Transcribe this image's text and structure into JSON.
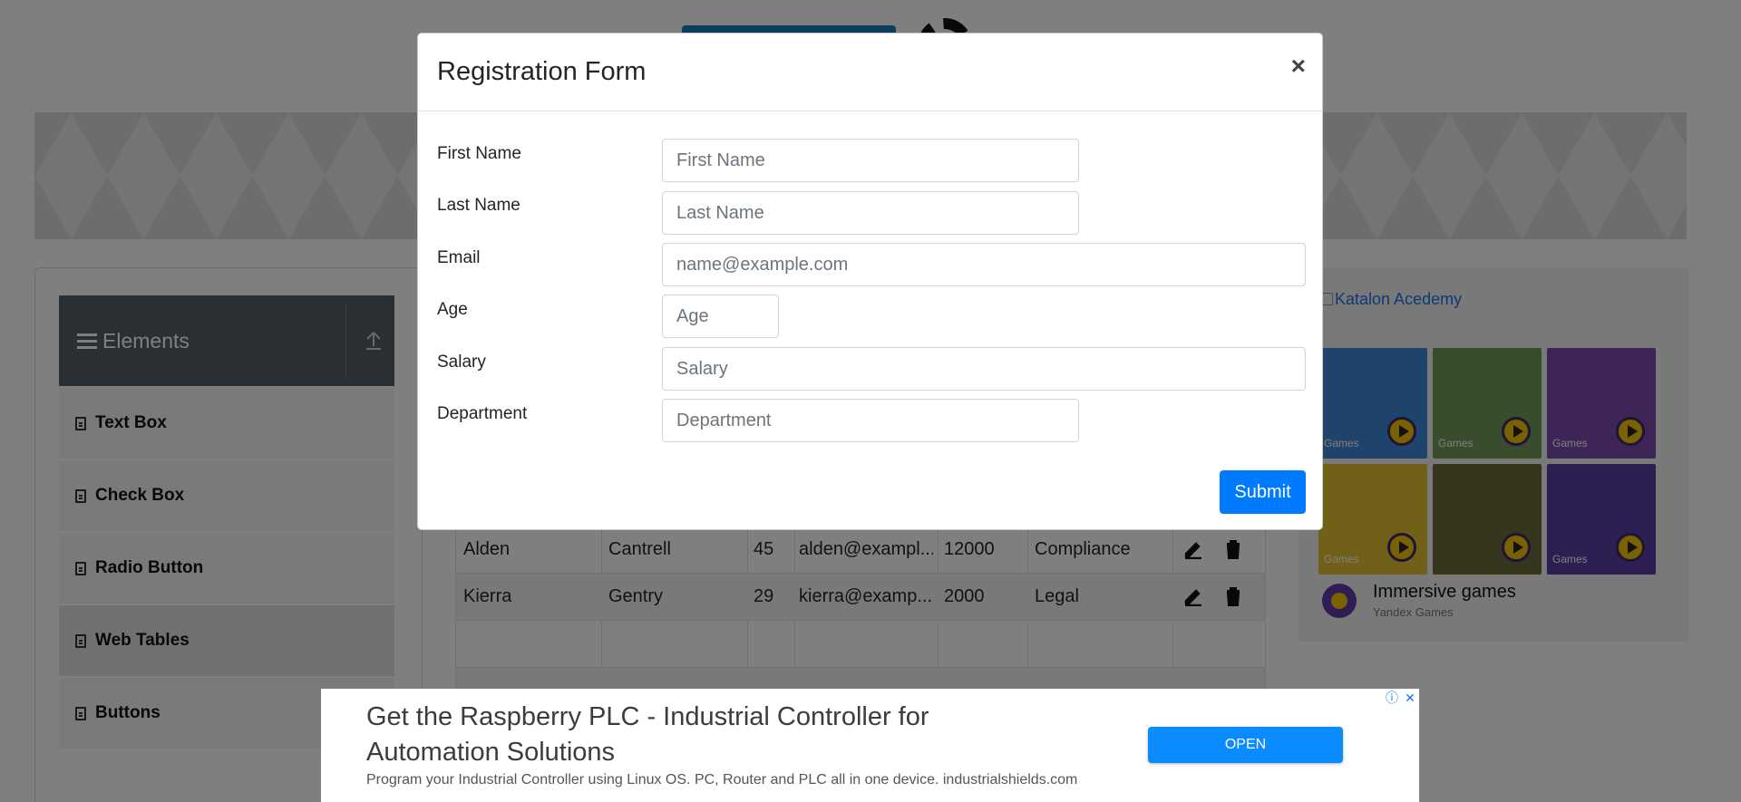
{
  "sidebar": {
    "group_title": "Elements",
    "items": [
      {
        "label": "Text Box"
      },
      {
        "label": "Check Box"
      },
      {
        "label": "Radio Button"
      },
      {
        "label": "Web Tables"
      },
      {
        "label": "Buttons"
      }
    ]
  },
  "table": {
    "rows": [
      {
        "first": "Alden",
        "last": "Cantrell",
        "age": "45",
        "email": "alden@exampl...",
        "salary": "12000",
        "department": "Compliance"
      },
      {
        "first": "Kierra",
        "last": "Gentry",
        "age": "29",
        "email": "kierra@examp...",
        "salary": "2000",
        "department": "Legal"
      }
    ]
  },
  "side_ad": {
    "image_alt": "Katalon Acedemy",
    "game_tag": "Games",
    "title": "Immersive games",
    "subtitle": "Yandex Games",
    "choices_info": "ⓘ",
    "choices_close": "✕"
  },
  "modal": {
    "title": "Registration Form",
    "close_symbol": "×",
    "fields": {
      "first_name": {
        "label": "First Name",
        "placeholder": "First Name",
        "value": ""
      },
      "last_name": {
        "label": "Last Name",
        "placeholder": "Last Name",
        "value": ""
      },
      "email": {
        "label": "Email",
        "placeholder": "name@example.com",
        "value": ""
      },
      "age": {
        "label": "Age",
        "placeholder": "Age",
        "value": ""
      },
      "salary": {
        "label": "Salary",
        "placeholder": "Salary",
        "value": ""
      },
      "department": {
        "label": "Department",
        "placeholder": "Department",
        "value": ""
      }
    },
    "submit_label": "Submit"
  },
  "bottom_ad": {
    "headline": "Get the Raspberry PLC - Industrial Controller for Automation Solutions",
    "description": "Program your Industrial Controller using Linux OS. PC, Router and PLC all in one device. industrialshields.com",
    "button_label": "OPEN",
    "choices_info": "ⓘ",
    "choices_close": "✕"
  },
  "colors": {
    "primary": "#007bff",
    "sidebar_header": "#545e69",
    "ad_button": "#0a8bff"
  }
}
